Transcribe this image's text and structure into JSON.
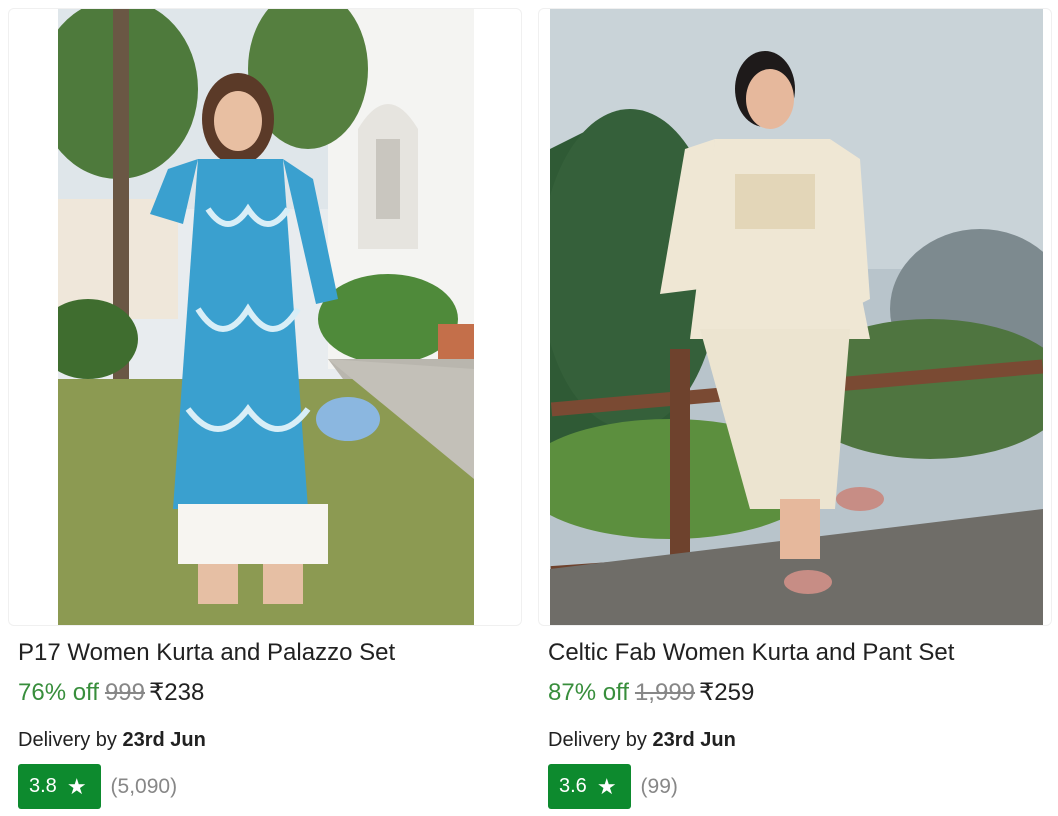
{
  "products": [
    {
      "title": "P17 Women Kurta and Palazzo Set",
      "discount": "76% off",
      "mrp": "999",
      "price": "₹238",
      "delivery_prefix": "Delivery by",
      "delivery_date": "23rd Jun",
      "rating": "3.8",
      "rating_count": "(5,090)",
      "star_icon": "star-icon"
    },
    {
      "title": "Celtic Fab Women Kurta and Pant Set",
      "discount": "87% off",
      "mrp": "1,999",
      "price": "₹259",
      "delivery_prefix": "Delivery by",
      "delivery_date": "23rd Jun",
      "rating": "3.6",
      "rating_count": "(99)",
      "star_icon": "star-icon"
    }
  ],
  "colors": {
    "discount": "#388e3c",
    "rating_badge": "#0d8a2e",
    "muted": "#878787"
  }
}
